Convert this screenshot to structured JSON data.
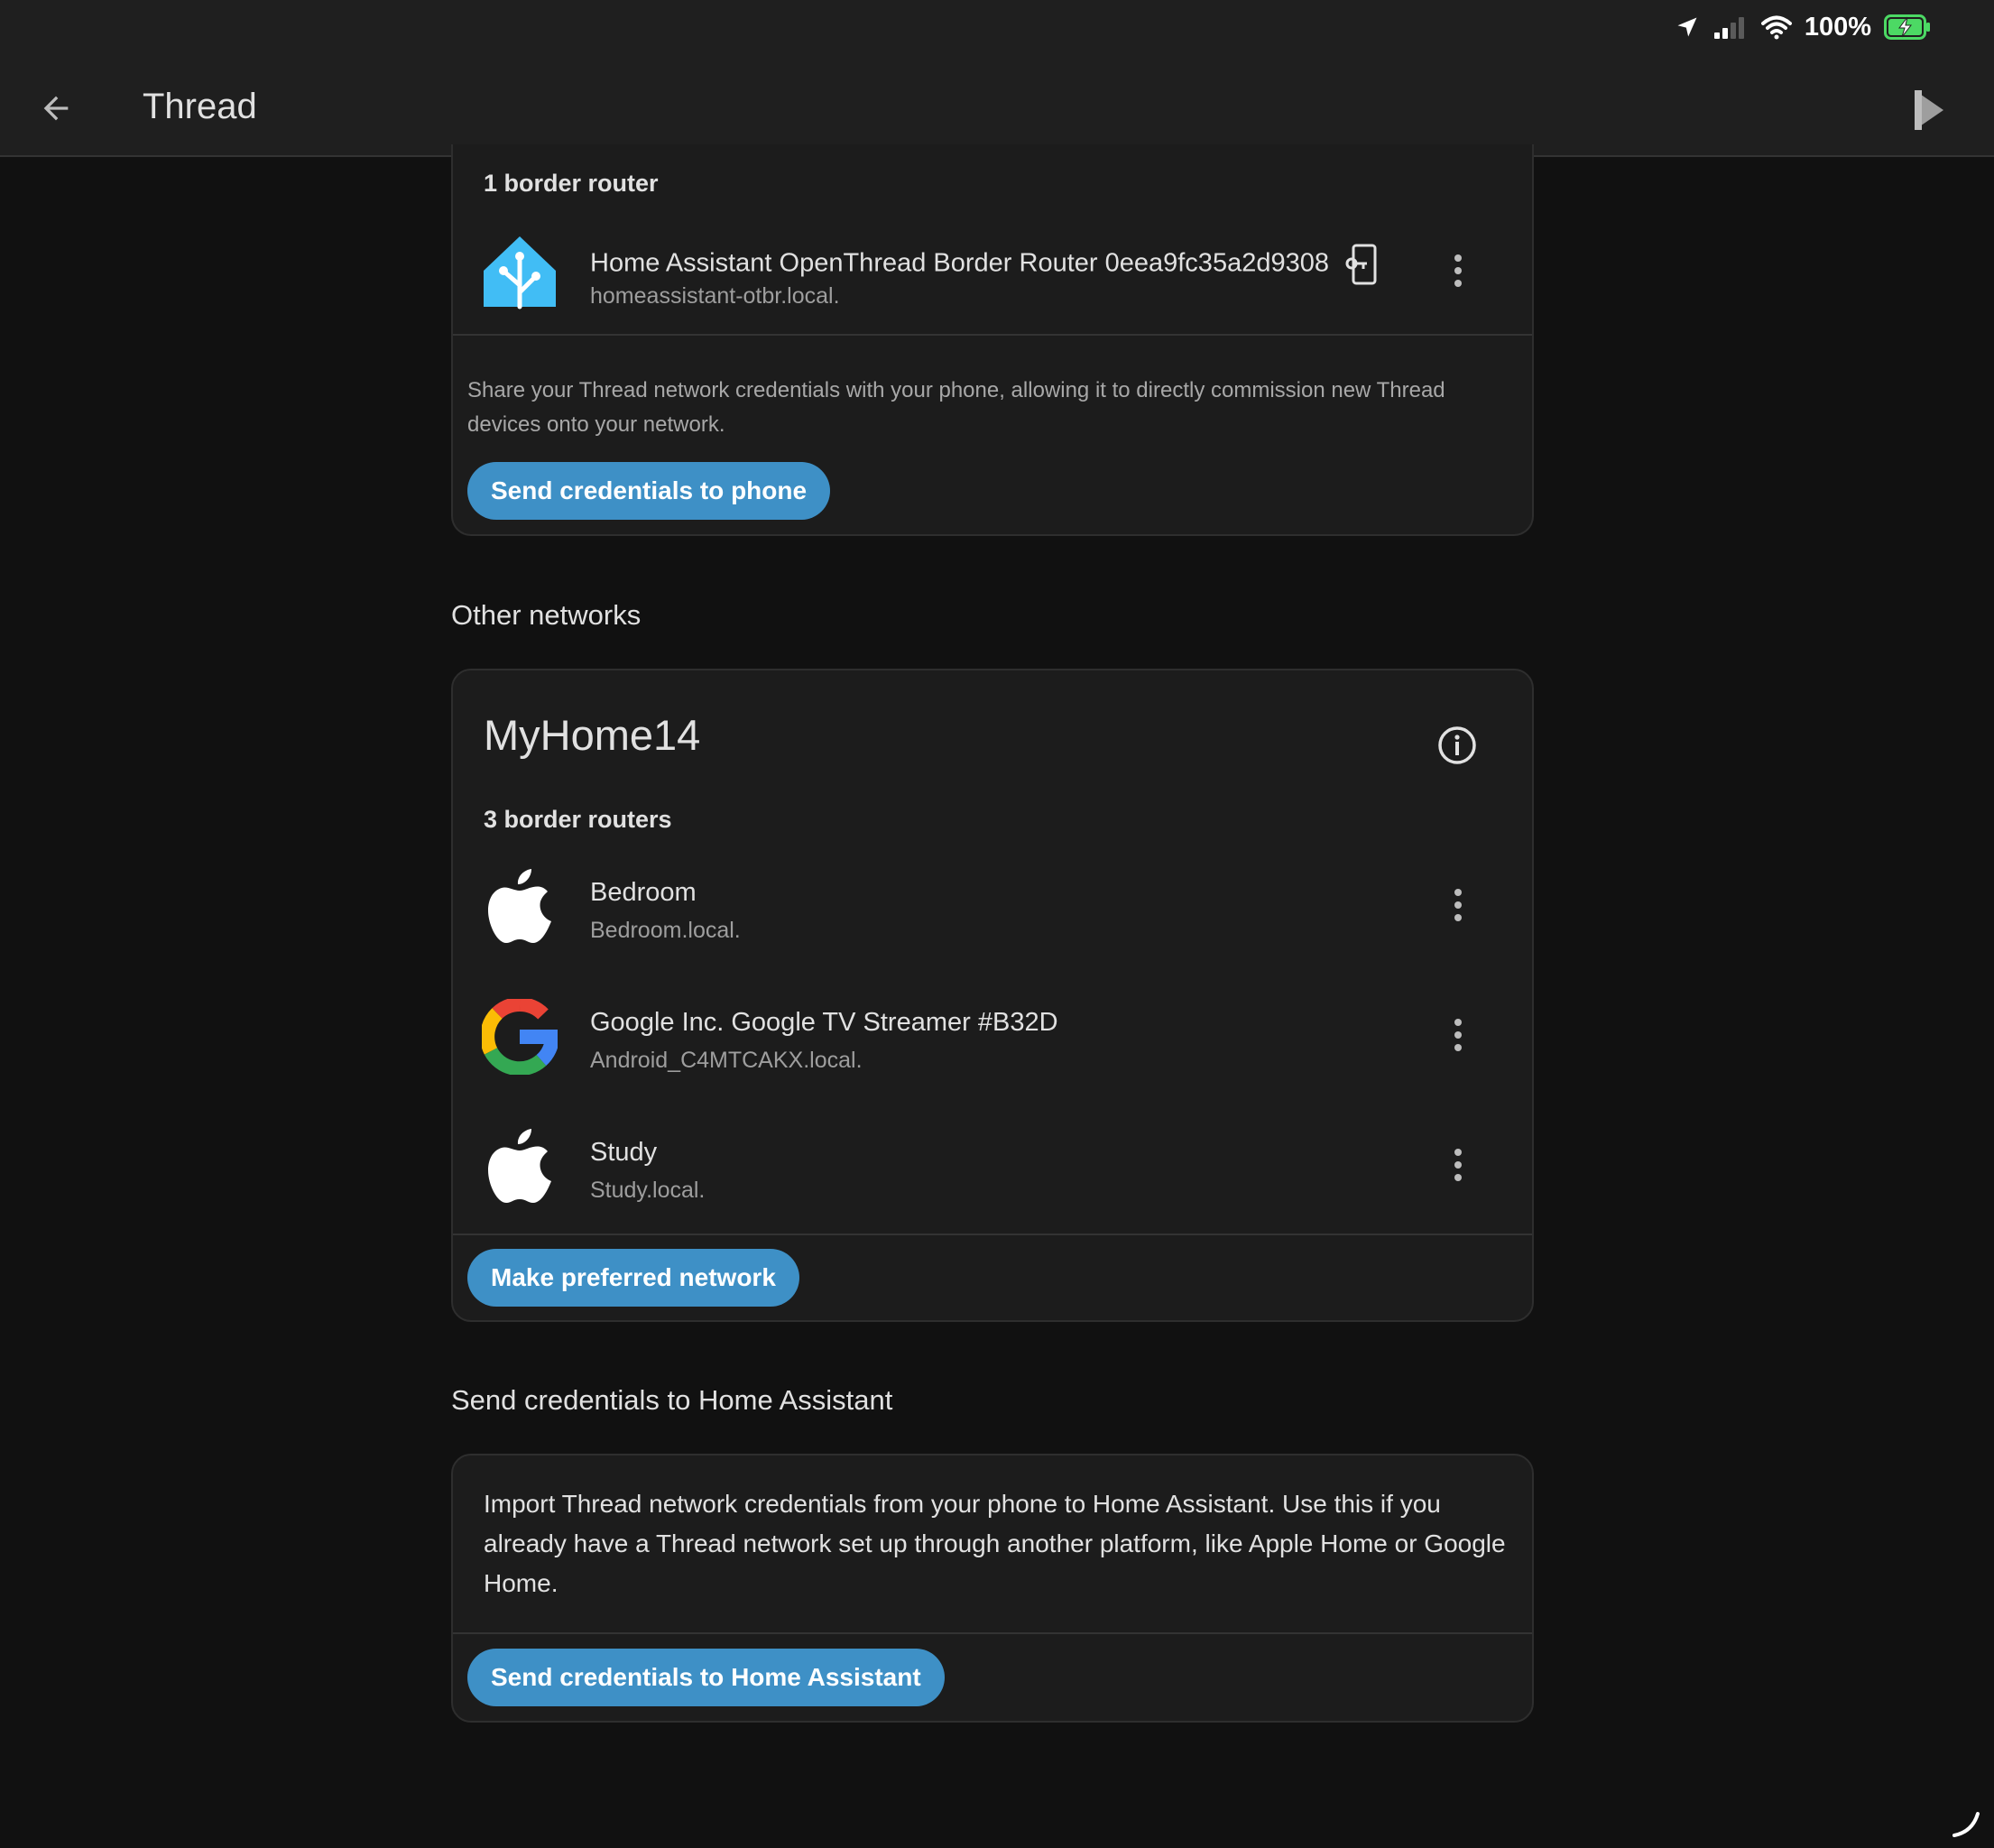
{
  "status_bar": {
    "battery_percent": "100%"
  },
  "app_bar": {
    "title": "Thread"
  },
  "preferred_card": {
    "router_count_label": "1 border router",
    "routers": [
      {
        "name": "Home Assistant OpenThread Border Router 0eea9fc35a2d9308",
        "host": "homeassistant-otbr.local.",
        "icon": "home-assistant-icon"
      }
    ],
    "share_description": "Share your Thread network credentials with your phone, allowing it to directly commission new Thread devices onto your network.",
    "send_to_phone_label": "Send credentials to phone"
  },
  "other_networks": {
    "section_title": "Other networks",
    "network": {
      "name": "MyHome14",
      "router_count_label": "3 border routers",
      "routers": [
        {
          "name": "Bedroom",
          "host": "Bedroom.local.",
          "icon": "apple-icon"
        },
        {
          "name": "Google Inc. Google TV Streamer #B32D",
          "host": "Android_C4MTCAKX.local.",
          "icon": "google-icon"
        },
        {
          "name": "Study",
          "host": "Study.local.",
          "icon": "apple-icon"
        }
      ],
      "make_preferred_label": "Make preferred network"
    }
  },
  "import_section": {
    "section_title": "Send credentials to Home Assistant",
    "description": "Import Thread network credentials from your phone to Home Assistant. Use this if you already have a Thread network set up through another platform, like Apple Home or Google Home.",
    "button_label": "Send credentials to Home Assistant"
  },
  "colors": {
    "background": "#111111",
    "card": "#1c1c1c",
    "accent": "#3e90c6",
    "home_assistant_blue": "#41bdf5",
    "battery_green": "#4cd964"
  }
}
